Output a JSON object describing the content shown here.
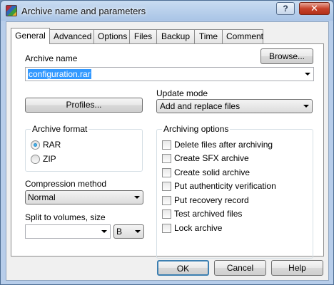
{
  "window": {
    "title": "Archive name and parameters",
    "help_glyph": "?",
    "close_glyph": "✕"
  },
  "tabs": [
    "General",
    "Advanced",
    "Options",
    "Files",
    "Backup",
    "Time",
    "Comment"
  ],
  "general": {
    "archive_name_label": "Archive name",
    "browse_label": "Browse...",
    "archive_name_value": "configuration.rar",
    "profiles_label": "Profiles...",
    "update_mode_label": "Update mode",
    "update_mode_value": "Add and replace files",
    "archive_format": {
      "title": "Archive format",
      "options": [
        {
          "label": "RAR",
          "selected": true
        },
        {
          "label": "ZIP",
          "selected": false
        }
      ]
    },
    "compression_label": "Compression method",
    "compression_value": "Normal",
    "split_label": "Split to volumes, size",
    "split_value": "",
    "split_unit": "B",
    "archiving_options": {
      "title": "Archiving options",
      "items": [
        {
          "label": "Delete files after archiving",
          "checked": false
        },
        {
          "label": "Create SFX archive",
          "checked": false
        },
        {
          "label": "Create solid archive",
          "checked": false
        },
        {
          "label": "Put authenticity verification",
          "checked": false
        },
        {
          "label": "Put recovery record",
          "checked": false
        },
        {
          "label": "Test archived files",
          "checked": false
        },
        {
          "label": "Lock archive",
          "checked": false
        }
      ]
    }
  },
  "footer": {
    "ok_label": "OK",
    "cancel_label": "Cancel",
    "help_label": "Help"
  }
}
